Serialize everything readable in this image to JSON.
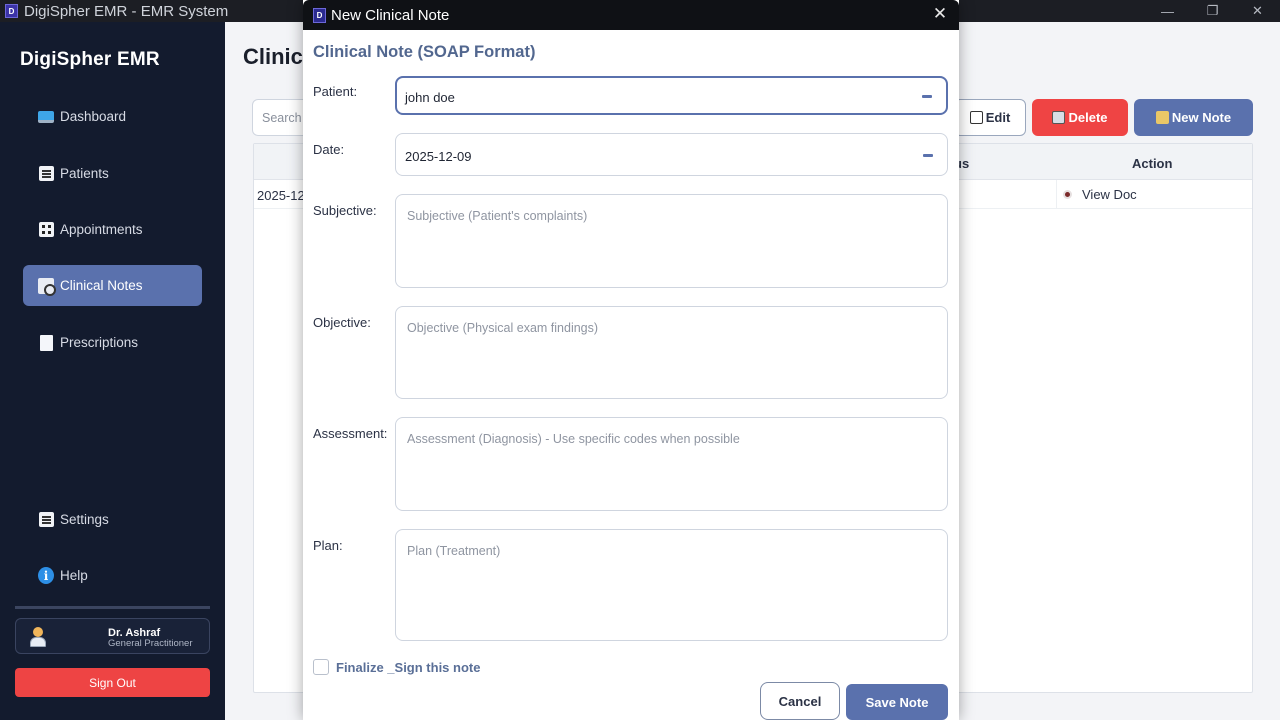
{
  "window": {
    "title": "DigiSpher EMR - EMR System",
    "app_icon": "D",
    "controls": [
      "—",
      "❐",
      "✕"
    ]
  },
  "sidebar": {
    "brand": "DigiSpher EMR",
    "items": [
      {
        "label": "Dashboard",
        "icon": "monitor-icon"
      },
      {
        "label": "Patients",
        "icon": "patients-list-icon"
      },
      {
        "label": "Appointments",
        "icon": "appointments-grid-icon"
      },
      {
        "label": "Clinical Notes",
        "icon": "clinical-notes-icon",
        "active": true
      },
      {
        "label": "Prescriptions",
        "icon": "document-icon"
      }
    ],
    "settings_label": "Settings",
    "help_label": "Help",
    "help_icon_glyph": "i",
    "user": {
      "name": "Dr. Ashraf",
      "role": "General Practitioner"
    },
    "signout_label": "Sign Out"
  },
  "main": {
    "title": "Clinic",
    "search_placeholder": "Search",
    "toolbar": {
      "edit_label": "Edit",
      "delete_label": "Delete",
      "new_label": "New Note"
    },
    "table": {
      "header_status_partial": "us",
      "header_action": "Action",
      "row_date_partial": "2025-12",
      "row_action": "View Doc"
    }
  },
  "dialog": {
    "title": "New Clinical Note",
    "app_icon": "D",
    "close_glyph": "✕",
    "heading": "Clinical Note (SOAP Format)",
    "patient_label": "Patient:",
    "patient_value": "john doe",
    "date_label": "Date:",
    "date_value": "2025-12-09",
    "subjective_label": "Subjective:",
    "subjective_placeholder": "Subjective (Patient's complaints)",
    "objective_label": "Objective:",
    "objective_placeholder": "Objective (Physical exam findings)",
    "assessment_label": "Assessment:",
    "assessment_placeholder": "Assessment (Diagnosis) - Use specific codes when possible",
    "plan_label": "Plan:",
    "plan_placeholder": "Plan (Treatment)",
    "finalize_label": "Finalize _Sign this note",
    "cancel_label": "Cancel",
    "save_label": "Save Note"
  },
  "colors": {
    "sidebar_bg": "#131b2e",
    "accent": "#5a71ad",
    "danger": "#ef4444",
    "heading": "#52678f"
  }
}
